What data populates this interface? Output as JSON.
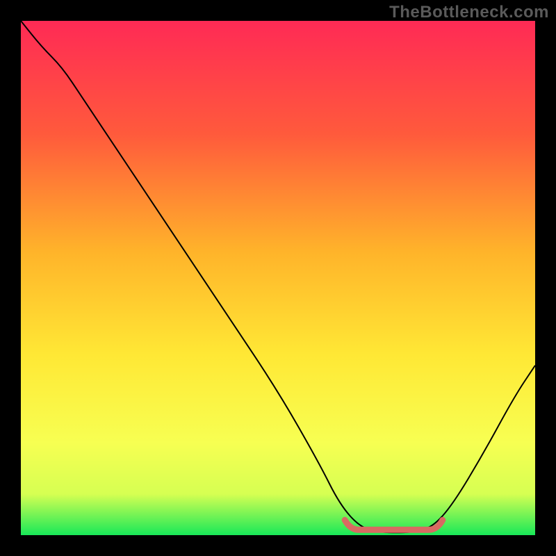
{
  "watermark": "TheBottleneck.com",
  "colors": {
    "frame": "#000000",
    "watermark": "#5a5a5a",
    "curve": "#000000",
    "highlight": "#d86a62",
    "gradient_stops": [
      {
        "offset": 0,
        "color": "#ff2a55"
      },
      {
        "offset": 0.22,
        "color": "#ff5a3c"
      },
      {
        "offset": 0.45,
        "color": "#ffb42a"
      },
      {
        "offset": 0.65,
        "color": "#ffe835"
      },
      {
        "offset": 0.82,
        "color": "#f7ff52"
      },
      {
        "offset": 0.92,
        "color": "#d6ff52"
      },
      {
        "offset": 1.0,
        "color": "#18e858"
      }
    ]
  },
  "chart_data": {
    "type": "line",
    "title": "",
    "xlabel": "",
    "ylabel": "",
    "xlim": [
      0,
      100
    ],
    "ylim": [
      0,
      100
    ],
    "curve": [
      {
        "x": 0,
        "y": 100
      },
      {
        "x": 4,
        "y": 95
      },
      {
        "x": 8,
        "y": 91
      },
      {
        "x": 12,
        "y": 85
      },
      {
        "x": 20,
        "y": 73
      },
      {
        "x": 30,
        "y": 58
      },
      {
        "x": 40,
        "y": 43
      },
      {
        "x": 50,
        "y": 28
      },
      {
        "x": 58,
        "y": 14
      },
      {
        "x": 62,
        "y": 6
      },
      {
        "x": 66,
        "y": 1.5
      },
      {
        "x": 70,
        "y": 0.5
      },
      {
        "x": 76,
        "y": 0.5
      },
      {
        "x": 80,
        "y": 1.5
      },
      {
        "x": 84,
        "y": 6
      },
      {
        "x": 90,
        "y": 16
      },
      {
        "x": 96,
        "y": 27
      },
      {
        "x": 100,
        "y": 33
      }
    ],
    "highlight_segment": {
      "x_start": 63,
      "x_end": 82,
      "y": 0.5
    }
  }
}
